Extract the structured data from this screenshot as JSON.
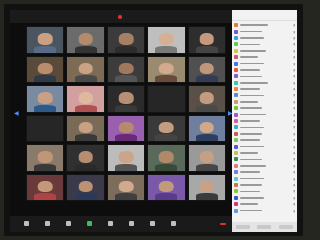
{
  "topbar": {
    "title": "",
    "view": ""
  },
  "colors": {
    "accent": "#3cbf53",
    "end": "#dd3333",
    "panel": "#f2f2f2"
  },
  "icons": [
    "record-icon",
    "mute-icon",
    "video-icon",
    "participants-icon",
    "share-screen-icon",
    "chat-icon",
    "record-button-icon",
    "reactions-icon"
  ],
  "grid": {
    "tiles": [
      {
        "name": "",
        "plain": false,
        "face": "#c9a081",
        "body": "#5a6b88",
        "bg": "#4a5560"
      },
      {
        "name": "",
        "plain": false,
        "face": "#b48a6c",
        "body": "#333333",
        "bg": "#6b6b6b"
      },
      {
        "name": "",
        "plain": false,
        "face": "#a77f63",
        "body": "#2c2c2c",
        "bg": "#3b3b3b"
      },
      {
        "name": "",
        "plain": false,
        "face": "#d6b095",
        "body": "#7a7a7a",
        "bg": "#bfbfbf"
      },
      {
        "name": "",
        "plain": false,
        "face": "#c59a7c",
        "body": "#444444",
        "bg": "#2e2e2e"
      },
      {
        "name": "",
        "plain": false,
        "face": "#b88c6f",
        "body": "#2f3a4a",
        "bg": "#5a4a3a"
      },
      {
        "name": "",
        "plain": false,
        "face": "#caa286",
        "body": "#4a4a4a",
        "bg": "#7d6b55"
      },
      {
        "name": "",
        "plain": false,
        "face": "#9f785e",
        "body": "#555555",
        "bg": "#3c3c3c"
      },
      {
        "name": "",
        "plain": false,
        "face": "#d2a98c",
        "body": "#6a4a3a",
        "bg": "#9a8a70"
      },
      {
        "name": "",
        "plain": false,
        "face": "#bf977a",
        "body": "#333b55",
        "bg": "#505050"
      },
      {
        "name": "",
        "plain": false,
        "face": "#c8a085",
        "body": "#2e5a8a",
        "bg": "#7a8aa0"
      },
      {
        "name": "",
        "plain": false,
        "face": "#e0b8a0",
        "body": "#b05050",
        "bg": "#d3a0a0"
      },
      {
        "name": "",
        "plain": false,
        "face": "#b78f72",
        "body": "#3a3a3a",
        "bg": "#2b2b2b"
      },
      {
        "name": "",
        "plain": true,
        "face": "",
        "body": "",
        "bg": "#262626",
        "big": ""
      },
      {
        "name": "",
        "plain": false,
        "face": "#c29b80",
        "body": "#4a4a4a",
        "bg": "#5b5048"
      },
      {
        "name": "",
        "plain": true,
        "face": "",
        "body": "",
        "bg": "#262626",
        "big": ""
      },
      {
        "name": "",
        "plain": false,
        "face": "#caa082",
        "body": "#3a3a3a",
        "bg": "#7a6a58"
      },
      {
        "name": "",
        "plain": false,
        "face": "#b58a6d",
        "body": "#6a2a7a",
        "bg": "#9a60b0"
      },
      {
        "name": "",
        "plain": false,
        "face": "#c49c7e",
        "body": "#444444",
        "bg": "#3a3a3a"
      },
      {
        "name": "",
        "plain": false,
        "face": "#d0a88a",
        "body": "#2f3f5f",
        "bg": "#6f7f9f"
      },
      {
        "name": "",
        "plain": false,
        "face": "#c09678",
        "body": "#3a3a3a",
        "bg": "#8a7a6a"
      },
      {
        "name": "",
        "plain": false,
        "face": "#b68d70",
        "body": "#2a2a2a",
        "bg": "#303030"
      },
      {
        "name": "",
        "plain": false,
        "face": "#cca487",
        "body": "#555555",
        "bg": "#bcbcbc"
      },
      {
        "name": "",
        "plain": false,
        "face": "#b18969",
        "body": "#3a4a3a",
        "bg": "#5a6a5a"
      },
      {
        "name": "",
        "plain": false,
        "face": "#c79f82",
        "body": "#474747",
        "bg": "#9a9a9a"
      },
      {
        "name": "",
        "plain": false,
        "face": "#c4977a",
        "body": "#b04444",
        "bg": "#6a3a3a"
      },
      {
        "name": "",
        "plain": false,
        "face": "#bd9274",
        "body": "#2a3a5a",
        "bg": "#3a3a4a"
      },
      {
        "name": "",
        "plain": false,
        "face": "#d1aa8d",
        "body": "#3f3f3f",
        "bg": "#7c6c5c"
      },
      {
        "name": "",
        "plain": false,
        "face": "#c19a7c",
        "body": "#5a3a8a",
        "bg": "#7a5aa8"
      },
      {
        "name": "",
        "plain": false,
        "face": "#caa184",
        "body": "#3b3b3b",
        "bg": "#a8a8a8"
      }
    ]
  },
  "panel": {
    "title": "",
    "participants": [
      {
        "color": "#e07a3a",
        "w": 0.7
      },
      {
        "color": "#7a5ac8",
        "w": 0.55
      },
      {
        "color": "#3aa0e0",
        "w": 0.6
      },
      {
        "color": "#5ac85a",
        "w": 0.5
      },
      {
        "color": "#e0c03a",
        "w": 0.65
      },
      {
        "color": "#c85a7a",
        "w": 0.45
      },
      {
        "color": "#3a7ae0",
        "w": 0.6
      },
      {
        "color": "#e05a3a",
        "w": 0.5
      },
      {
        "color": "#8a5ac8",
        "w": 0.55
      },
      {
        "color": "#3ac8a0",
        "w": 0.7
      },
      {
        "color": "#e08a3a",
        "w": 0.5
      },
      {
        "color": "#5a8ac8",
        "w": 0.6
      },
      {
        "color": "#c8a05a",
        "w": 0.45
      },
      {
        "color": "#6ac83a",
        "w": 0.55
      },
      {
        "color": "#a05ac8",
        "w": 0.65
      },
      {
        "color": "#e05a9a",
        "w": 0.5
      },
      {
        "color": "#3ab0c8",
        "w": 0.6
      },
      {
        "color": "#c85a5a",
        "w": 0.55
      },
      {
        "color": "#7ac85a",
        "w": 0.5
      },
      {
        "color": "#5a5ac8",
        "w": 0.6
      },
      {
        "color": "#c8c05a",
        "w": 0.45
      },
      {
        "color": "#3a8a5a",
        "w": 0.55
      },
      {
        "color": "#e07a7a",
        "w": 0.65
      },
      {
        "color": "#7a7ae0",
        "w": 0.5
      },
      {
        "color": "#5ac8c8",
        "w": 0.6
      },
      {
        "color": "#c87a3a",
        "w": 0.55
      },
      {
        "color": "#8ac83a",
        "w": 0.5
      },
      {
        "color": "#3a5ac8",
        "w": 0.6
      },
      {
        "color": "#c83a8a",
        "w": 0.45
      },
      {
        "color": "#5a9ae0",
        "w": 0.55
      }
    ]
  },
  "toolbar": {
    "buttons": [
      {
        "label": "",
        "green": false
      },
      {
        "label": "",
        "green": false
      },
      {
        "label": "",
        "green": false
      },
      {
        "label": "",
        "green": true
      },
      {
        "label": "",
        "green": false
      },
      {
        "label": "",
        "green": false
      },
      {
        "label": "",
        "green": false
      },
      {
        "label": "",
        "green": false
      }
    ],
    "end_label": ""
  }
}
